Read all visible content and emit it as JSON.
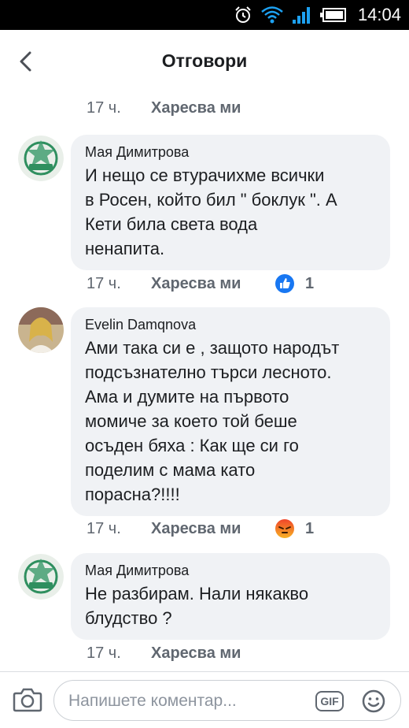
{
  "status_bar": {
    "time": "14:04"
  },
  "header": {
    "title": "Отговори"
  },
  "comments": [
    {
      "time": "17 ч.",
      "like_label": "Харесва ми"
    },
    {
      "author": "Мая Димитрова",
      "text_lines": [
        "И нещо се втурачихме всички",
        "в Росен, който бил \" боклук \". А",
        "Кети била света вода",
        "ненапита."
      ],
      "time": "17 ч.",
      "like_label": "Харесва ми",
      "reaction": {
        "icon": "like-reaction-icon",
        "count": "1",
        "color": "#1877f2"
      }
    },
    {
      "author": "Evelin Damqnova",
      "text_lines": [
        "Ами така си е , защото народът",
        "подсъзнателно търси лесното.",
        "Ама и думите на първото",
        "момиче за което той беше",
        "осъден бяха : Как ще си го",
        "поделим с мама като",
        "порасна?!!!!"
      ],
      "time": "17 ч.",
      "like_label": "Харесва ми",
      "reaction": {
        "icon": "angry-reaction-icon",
        "count": "1",
        "color": "#e9710f"
      }
    },
    {
      "author": "Мая Димитрова",
      "text_lines": [
        "Не разбирам. Нали някакво",
        "блудство ?"
      ],
      "time": "17 ч.",
      "like_label": "Харесва ми"
    }
  ],
  "composer": {
    "placeholder": "Напишете коментар...",
    "gif_label": "GIF"
  }
}
